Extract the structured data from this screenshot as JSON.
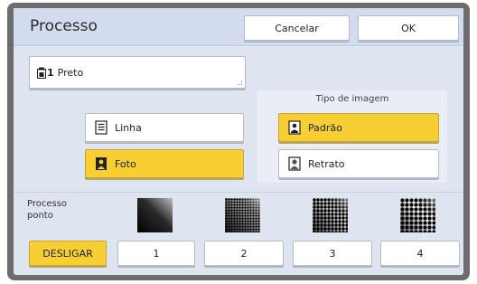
{
  "header": {
    "title": "Processo",
    "cancel_label": "Cancelar",
    "ok_label": "OK"
  },
  "color_field": {
    "drum_number": "1",
    "value": "Preto"
  },
  "image_type": {
    "label": "Tipo de imagem",
    "options": [
      {
        "label": "Padrão",
        "selected": true
      },
      {
        "label": "Retrato",
        "selected": false
      }
    ]
  },
  "original_type": {
    "options": [
      {
        "label": "Linha",
        "selected": false
      },
      {
        "label": "Foto",
        "selected": true
      }
    ]
  },
  "dot_process": {
    "label_line1": "Processo",
    "label_line2": "ponto",
    "off_label": "DESLIGAR",
    "off_selected": true,
    "levels": [
      "1",
      "2",
      "3",
      "4"
    ]
  },
  "colors": {
    "accent": "#f7cf33",
    "panel": "#dfe4f1",
    "frame": "#6c6c6c"
  }
}
